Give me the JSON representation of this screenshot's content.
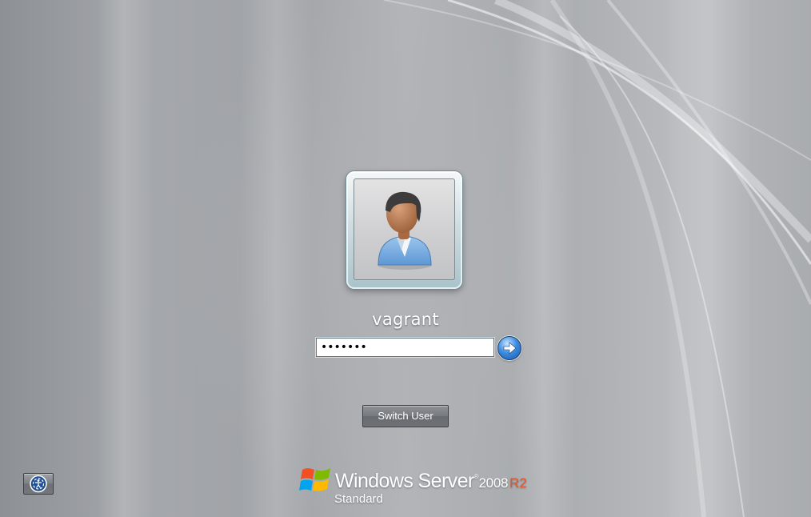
{
  "login": {
    "username": "vagrant",
    "password_value": "•••••••",
    "switch_user_label": "Switch User"
  },
  "branding": {
    "product": "Windows Server",
    "trademark": "®",
    "version": "2008",
    "release": "R2",
    "edition": "Standard"
  },
  "icons": {
    "user_tile": "user-avatar-icon",
    "submit": "arrow-right-icon",
    "ease_of_access": "ease-of-access-icon",
    "logo": "windows-flag-logo"
  },
  "colors": {
    "background": "#a4a7aa",
    "accent_arrow": "#3d8de0",
    "release_tag": "#e5552b"
  }
}
